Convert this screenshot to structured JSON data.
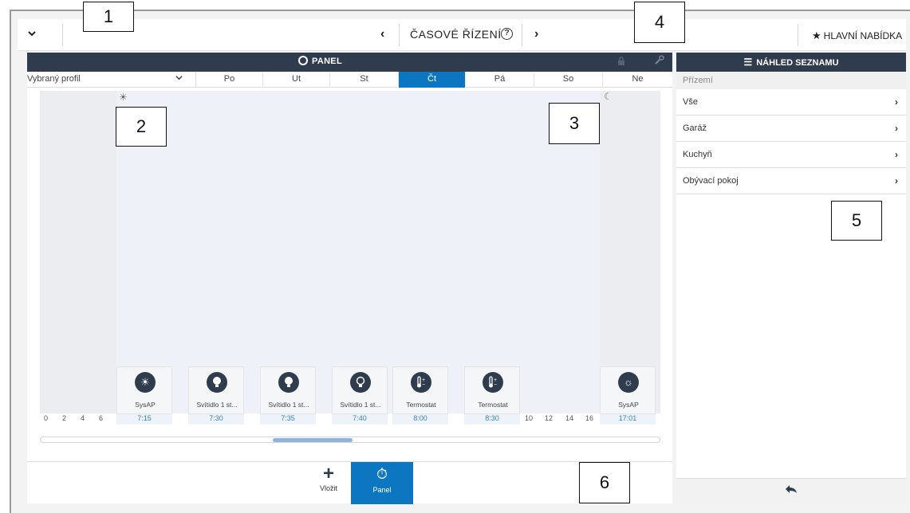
{
  "topbar": {
    "collapse_glyph": "⌄",
    "prev_glyph": "‹",
    "title": "ČASOVÉ ŘÍZENÍ",
    "help_glyph": "?",
    "next_glyph": "›",
    "main_menu_label": "HLAVNÍ NABÍDKA"
  },
  "panel": {
    "title": "PANEL",
    "profile_label": "Vybraný profil",
    "days": [
      "Po",
      "Ut",
      "St",
      "Čt",
      "Pá",
      "So",
      "Ne"
    ],
    "active_day": "Čt"
  },
  "timeline": {
    "hours_left": [
      "0",
      "2",
      "4",
      "6"
    ],
    "hours_right": [
      "10",
      "12",
      "14",
      "16"
    ],
    "events": [
      {
        "label": "SysAP",
        "time": "7:15",
        "icon": "sun-icon"
      },
      {
        "label": "Svítidlo 1 st...",
        "time": "7:30",
        "icon": "bulb-on-icon"
      },
      {
        "label": "Svítidlo 1 st...",
        "time": "7:35",
        "icon": "bulb-on-icon"
      },
      {
        "label": "Svítidlo 1 st...",
        "time": "7:40",
        "icon": "bulb-off-icon"
      },
      {
        "label": "Termostat",
        "time": "8:00",
        "icon": "thermostat-icon"
      },
      {
        "label": "Termostat",
        "time": "8:30",
        "icon": "thermostat-icon"
      },
      {
        "label": "SysAP",
        "time": "17:01",
        "icon": "sun-outline-icon"
      }
    ],
    "scroll_fraction": 0.43
  },
  "bottombar": {
    "insert_label": "Vložit",
    "panel_label": "Panel"
  },
  "rpanel": {
    "title": "NÁHLED SEZNAMU",
    "group": "Přízemí",
    "items": [
      "Vše",
      "Garáž",
      "Kuchyň",
      "Obývací pokoj"
    ]
  },
  "callouts": [
    "1",
    "2",
    "3",
    "4",
    "5",
    "6"
  ],
  "colors": {
    "header_bg": "#2f3c4e",
    "accent": "#0d76c0"
  }
}
